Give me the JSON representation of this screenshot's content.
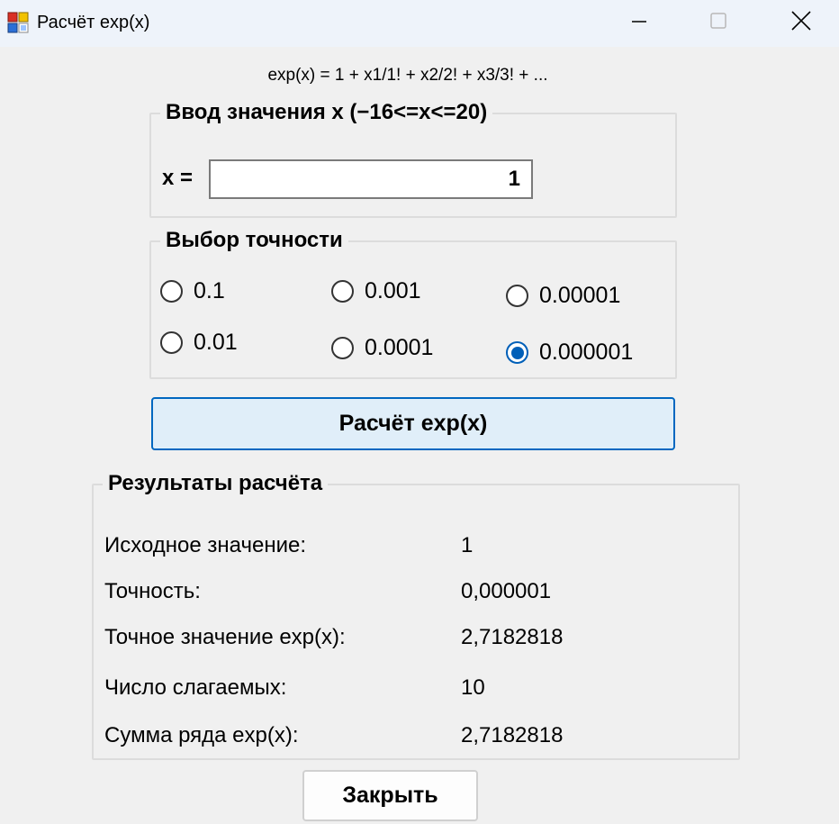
{
  "window": {
    "title": "Расчёт exp(x)",
    "accent_color": "#005fb8"
  },
  "formula": "exp(x) = 1 + x1/1! + x2/2! + x3/3! + ...",
  "input_group": {
    "title": "Ввод значения x (−16<=x<=20)",
    "x_label": "x =",
    "x_value": "1"
  },
  "precision_group": {
    "title": "Выбор точности",
    "options": [
      "0.1",
      "0.001",
      "0.00001",
      "0.01",
      "0.0001",
      "0.000001"
    ],
    "selected": "0.000001"
  },
  "calc_button": {
    "label": "Расчёт exp(x)"
  },
  "results_group": {
    "title": "Результаты расчёта",
    "rows": [
      {
        "label": "Исходное значение:",
        "value": "1"
      },
      {
        "label": "Точность:",
        "value": "0,000001"
      },
      {
        "label": "Точное значение exp(x):",
        "value": "2,7182818"
      },
      {
        "label": "Число слагаемых:",
        "value": "10"
      },
      {
        "label": "Сумма ряда exp(x):",
        "value": "2,7182818"
      }
    ]
  },
  "close_button": {
    "label": "Закрыть"
  }
}
